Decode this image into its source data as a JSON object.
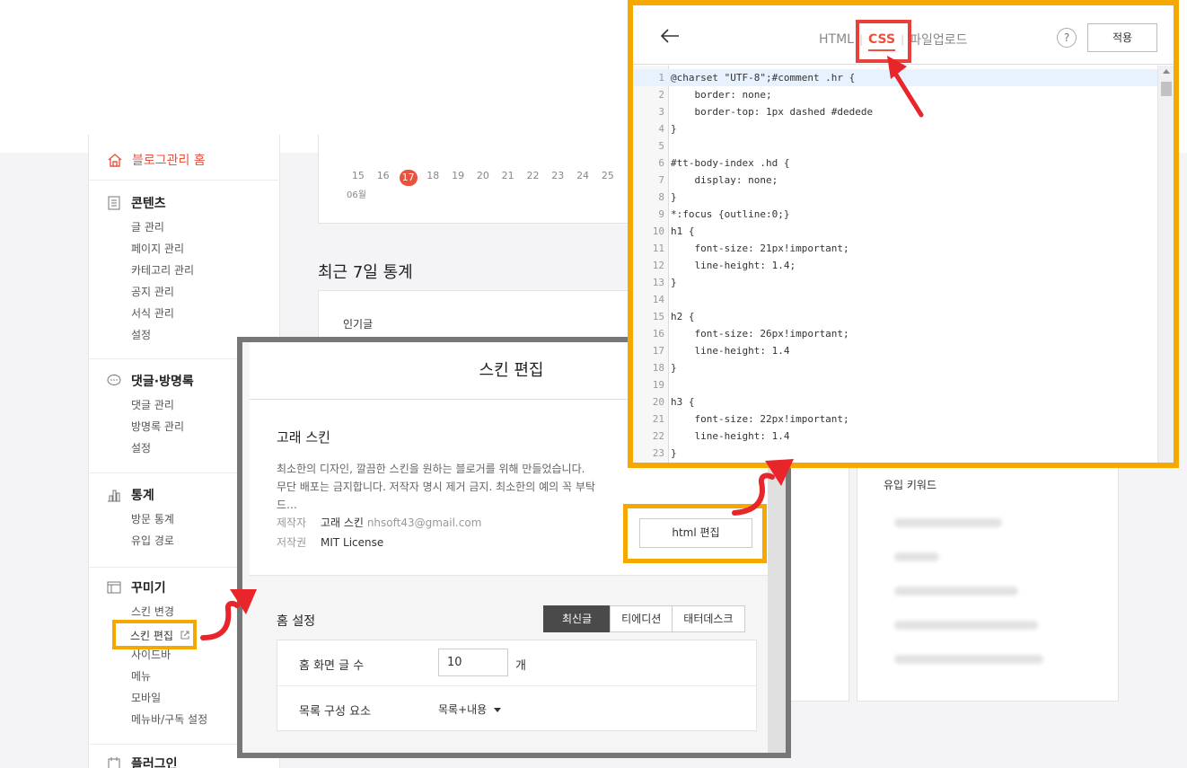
{
  "sidebar": {
    "home": "블로그관리 홈",
    "sections": [
      {
        "title": "콘텐츠",
        "icon": "document-icon",
        "items": [
          "글 관리",
          "페이지 관리",
          "카테고리 관리",
          "공지 관리",
          "서식 관리",
          "설정"
        ]
      },
      {
        "title": "댓글·방명록",
        "icon": "comment-icon",
        "items": [
          "댓글 관리",
          "방명록 관리",
          "설정"
        ]
      },
      {
        "title": "통계",
        "icon": "bar-chart-icon",
        "items": [
          "방문 통계",
          "유입 경로"
        ]
      },
      {
        "title": "꾸미기",
        "icon": "layout-icon",
        "items": [
          "스킨 변경",
          "스킨 편집",
          "사이드바",
          "메뉴",
          "모바일",
          "메뉴바/구독 설정"
        ]
      },
      {
        "title": "플러그인",
        "icon": "plugin-icon",
        "items": []
      }
    ]
  },
  "stats": {
    "dates": [
      "15",
      "16",
      "17",
      "18",
      "19",
      "20",
      "21",
      "22",
      "23",
      "24",
      "25"
    ],
    "today": "17",
    "month": "06월",
    "section_title": "최근 7일 통계",
    "popular_label": "인기글",
    "keyword_label": "유입 키워드"
  },
  "skin_editor": {
    "title": "스킨 편집",
    "skin_name": "고래 스킨",
    "desc1": "최소한의 디자인, 깔끔한 스킨을 원하는 블로거를 위해 만들었습니다.",
    "desc2": "무단 배포는 금지합니다. 저작자 명시 제거 금지. 최소한의 예의 꼭 부탁 드…",
    "author_label": "제작자",
    "author": "고래 스킨",
    "author_email": "nhsoft43@gmail.com",
    "license_label": "저작권",
    "license": "MIT License",
    "html_edit_button": "html 편집",
    "home_settings_title": "홈 설정",
    "segments": [
      "최신글",
      "티에디션",
      "태터데스크"
    ],
    "post_count_label": "홈 화면 글 수",
    "post_count_value": "10",
    "post_count_unit": "개",
    "list_components_label": "목록 구성 요소",
    "list_components_value": "목록+내용"
  },
  "css_editor": {
    "tabs": [
      "HTML",
      "CSS",
      "파일업로드"
    ],
    "active_tab": "CSS",
    "help": "?",
    "apply_button": "적용",
    "lines": [
      "@charset \"UTF-8\";#comment .hr {",
      "    border: none;",
      "    border-top: 1px dashed #dedede",
      "}",
      "",
      "#tt-body-index .hd {",
      "    display: none;",
      "}",
      "*:focus {outline:0;}",
      "h1 {",
      "    font-size: 21px!important;",
      "    line-height: 1.4;",
      "}",
      "",
      "h2 {",
      "    font-size: 26px!important;",
      "    line-height: 1.4",
      "}",
      "",
      "h3 {",
      "    font-size: 22px!important;",
      "    line-height: 1.4",
      "}"
    ]
  },
  "colors": {
    "accent": "#e8523f",
    "highlight_orange": "#f5a800",
    "highlight_red": "#e8403a",
    "arrow_red": "#e8252b"
  }
}
